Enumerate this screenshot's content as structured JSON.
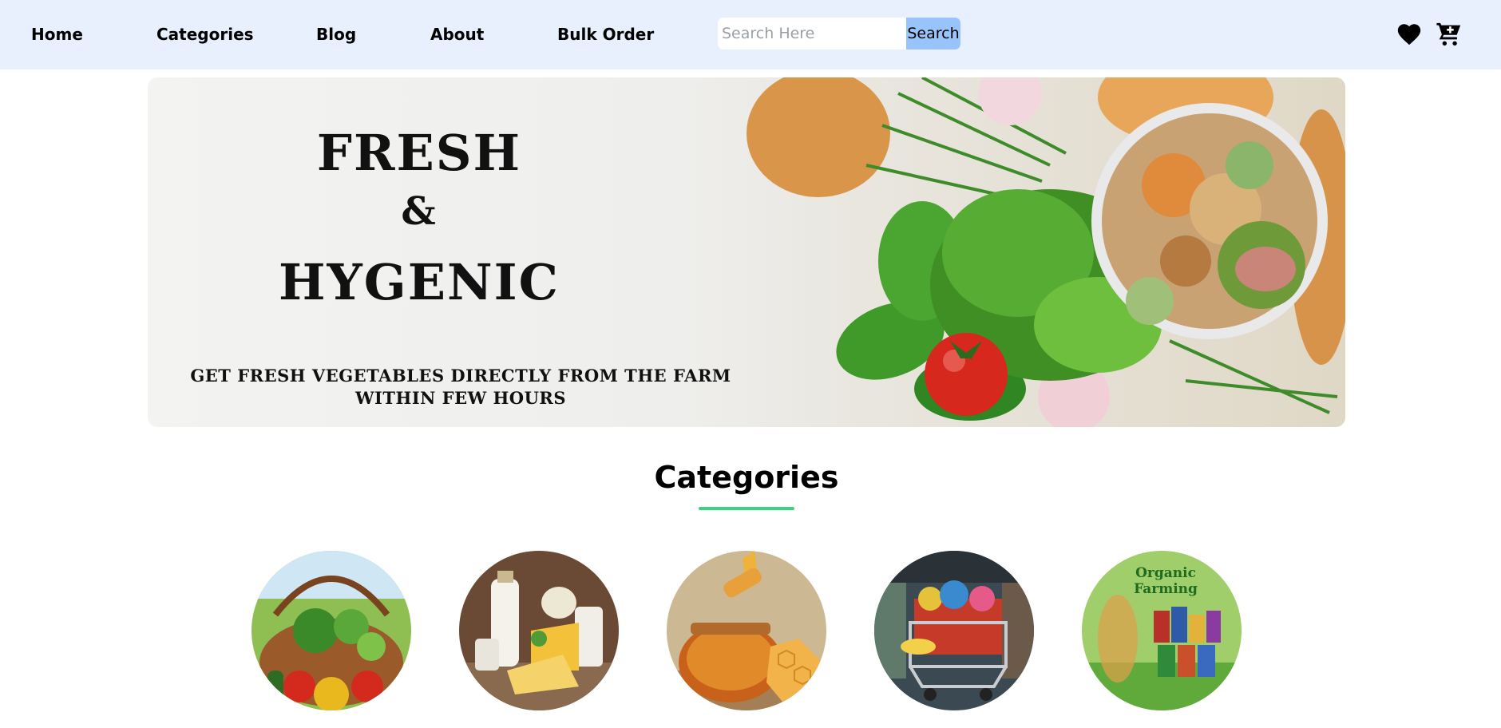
{
  "nav": {
    "links": [
      "Home",
      "Categories",
      "Blog",
      "About",
      "Bulk Order"
    ],
    "search_placeholder": "Search Here",
    "search_button": "Search",
    "icons": [
      "heart-icon",
      "cart-plus-icon"
    ]
  },
  "hero": {
    "line1": "FRESH",
    "line2": "&",
    "line3": "HYGENIC",
    "subtitle": "GET FRESH VEGETABLES DIRECTLY FROM THE FARM WITHIN FEW HOURS"
  },
  "categories": {
    "title": "Categories",
    "underline_color": "#3bd37d",
    "items": [
      {
        "image": "vegetable-basket"
      },
      {
        "image": "dairy-products"
      },
      {
        "image": "honey-jar"
      },
      {
        "image": "grocery-cart"
      },
      {
        "image": "organic-farming",
        "label": "Organic Farming"
      }
    ]
  },
  "colors": {
    "nav_bg": "#e8f0fe",
    "search_button_bg": "#99c3fb"
  }
}
